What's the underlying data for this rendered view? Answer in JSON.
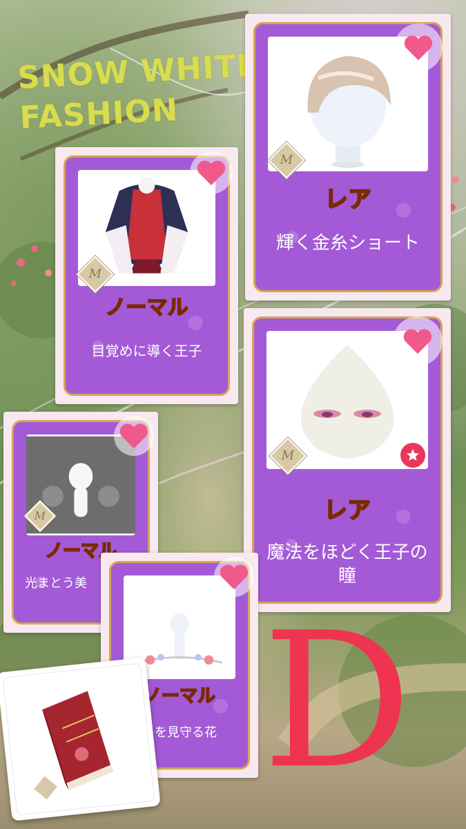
{
  "title": {
    "line1": "SNOW WHITE",
    "line2": "FASHION"
  },
  "cards": [
    {
      "rarity": "ノーマル",
      "name": "目覚めに導く王子",
      "art": "prince-outfit"
    },
    {
      "rarity": "レア",
      "name": "輝く金糸ショート",
      "art": "short-hair"
    },
    {
      "rarity": "レア",
      "name": "魔法をほどく王子の瞳",
      "art": "prince-eyes"
    },
    {
      "rarity": "ノーマル",
      "name": "光まとう美",
      "art": "light-sparkle"
    },
    {
      "rarity": "ノーマル",
      "name": "りを見守る花",
      "art": "flower-ornament"
    }
  ],
  "brand_mark": "M",
  "grade_letter": "D",
  "colors": {
    "title": "#d8dc4e",
    "card_purple": "#a45ad7",
    "card_border": "#d6a64f",
    "heart": "#f05a8a",
    "grade": "#ee3450"
  },
  "icons": [
    "heart-icon",
    "brand-m-icon",
    "star-badge-icon",
    "book-icon"
  ]
}
